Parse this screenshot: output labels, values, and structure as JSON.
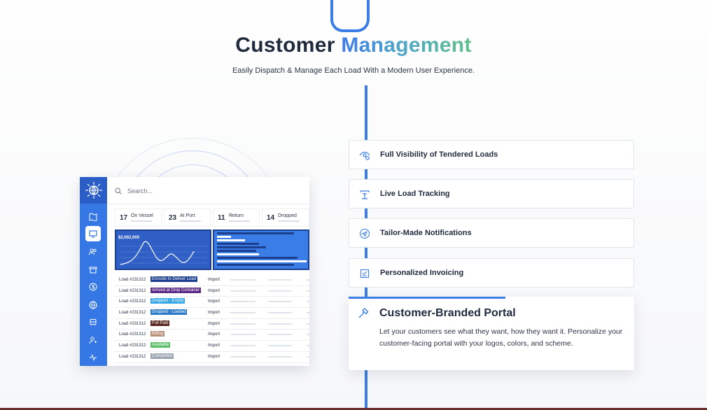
{
  "header": {
    "title_dark": "Customer ",
    "title_accent": "Management",
    "subtitle": "Easily Dispatch & Manage Each Load With a Modern User Experience."
  },
  "colors": {
    "accent": "#3a7de6",
    "text": "#1f2a3d",
    "sidebar": "#3578e5"
  },
  "mockup": {
    "search_placeholder": "Search...",
    "stats": [
      {
        "num": "17",
        "label": "On Vessel"
      },
      {
        "num": "23",
        "label": "At Port"
      },
      {
        "num": "11",
        "label": "Return"
      },
      {
        "num": "14",
        "label": "Dropped"
      }
    ],
    "chart_amount": "$2,002,000",
    "rows": [
      {
        "load": "Load #231312",
        "status": "Enroute to Deliver Load",
        "color": "#1c3f8e",
        "type": "Import"
      },
      {
        "load": "Load #231312",
        "status": "Arrived at Drop Container",
        "color": "#5b2a86",
        "type": "Import"
      },
      {
        "load": "Load #231312",
        "status": "Dropped - Empty",
        "color": "#35a6e8",
        "type": "Import"
      },
      {
        "load": "Load #231312",
        "status": "Dropped - Loaded",
        "color": "#2a78c8",
        "type": "Import"
      },
      {
        "load": "Load #231312",
        "status": "Full Paid",
        "color": "#5a2a22",
        "type": "Import"
      },
      {
        "load": "Load #231312",
        "status": "Billing",
        "color": "#b8917a",
        "type": "Import"
      },
      {
        "load": "Load #231312",
        "status": "Available",
        "color": "#5cc06a",
        "type": "Import"
      },
      {
        "load": "Load #231312",
        "status": "Completed",
        "color": "#9aa3b0",
        "type": "Import"
      }
    ]
  },
  "features": [
    {
      "label": "Full Visibility of Tendered Loads",
      "icon": "eye-pin-icon"
    },
    {
      "label": "Live Load Tracking",
      "icon": "tracking-icon"
    },
    {
      "label": "Tailor-Made Notifications",
      "icon": "send-icon"
    },
    {
      "label": "Personalized Invoicing",
      "icon": "invoice-icon"
    }
  ],
  "active_feature": {
    "title": "Customer-Branded Portal",
    "description": "Let your customers see what they want, how they want it. Personalize your customer-facing portal with your logos, colors, and scheme.",
    "icon": "hammer-icon"
  }
}
